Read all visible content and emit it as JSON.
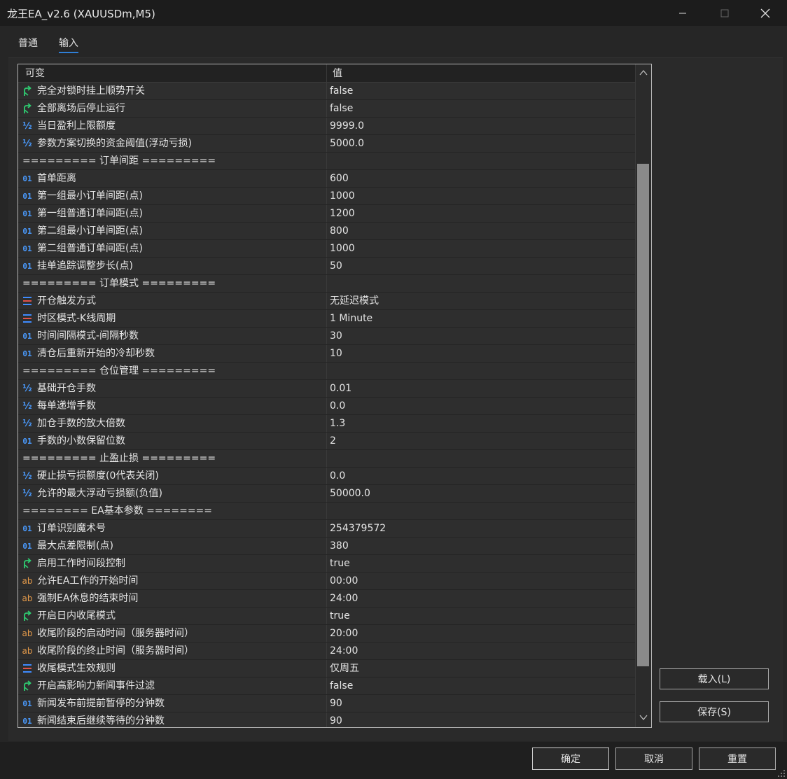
{
  "window": {
    "title": "龙王EA_v2.6 (XAUUSDm,M5)"
  },
  "tabs": [
    {
      "label": "普通"
    },
    {
      "label": "输入"
    }
  ],
  "grid": {
    "col_name": "可变",
    "col_value": "值"
  },
  "rows": [
    {
      "type": "bool",
      "name": "完全对锁时挂上顺势开关",
      "value": "false"
    },
    {
      "type": "bool",
      "name": "全部离场后停止运行",
      "value": "false"
    },
    {
      "type": "double",
      "name": "当日盈利上限额度",
      "value": "9999.0"
    },
    {
      "type": "double",
      "name": "参数方案切换的资金阈值(浮动亏损)",
      "value": "5000.0"
    },
    {
      "type": "separator",
      "name": "========= 订单间距 =========",
      "value": ""
    },
    {
      "type": "int",
      "name": "首单距离",
      "value": "600"
    },
    {
      "type": "int",
      "name": "第一组最小订单间距(点)",
      "value": "1000"
    },
    {
      "type": "int",
      "name": "第一组普通订单间距(点)",
      "value": "1200"
    },
    {
      "type": "int",
      "name": "第二组最小订单间距(点)",
      "value": "800"
    },
    {
      "type": "int",
      "name": "第二组普通订单间距(点)",
      "value": "1000"
    },
    {
      "type": "int",
      "name": "挂单追踪调整步长(点)",
      "value": "50"
    },
    {
      "type": "separator",
      "name": "========= 订单模式 =========",
      "value": ""
    },
    {
      "type": "enum",
      "name": "开仓触发方式",
      "value": "无延迟模式"
    },
    {
      "type": "enum",
      "name": "时区模式-K线周期",
      "value": "1 Minute"
    },
    {
      "type": "int",
      "name": "时间间隔模式-间隔秒数",
      "value": "30"
    },
    {
      "type": "int",
      "name": "清仓后重新开始的冷却秒数",
      "value": "10"
    },
    {
      "type": "separator",
      "name": "========= 仓位管理 =========",
      "value": ""
    },
    {
      "type": "double",
      "name": "基础开仓手数",
      "value": "0.01"
    },
    {
      "type": "double",
      "name": "每单递增手数",
      "value": "0.0"
    },
    {
      "type": "double",
      "name": "加仓手数的放大倍数",
      "value": "1.3"
    },
    {
      "type": "int",
      "name": "手数的小数保留位数",
      "value": "2"
    },
    {
      "type": "separator",
      "name": "========= 止盈止损 =========",
      "value": ""
    },
    {
      "type": "double",
      "name": "硬止损亏损额度(0代表关闭)",
      "value": "0.0"
    },
    {
      "type": "double",
      "name": "允许的最大浮动亏损额(负值)",
      "value": "50000.0"
    },
    {
      "type": "separator",
      "name": "======== EA基本参数 ========",
      "value": ""
    },
    {
      "type": "int",
      "name": "订单识别魔术号",
      "value": "254379572"
    },
    {
      "type": "int",
      "name": "最大点差限制(点)",
      "value": "380"
    },
    {
      "type": "bool",
      "name": "启用工作时间段控制",
      "value": "true"
    },
    {
      "type": "string",
      "name": "允许EA工作的开始时间",
      "value": "00:00"
    },
    {
      "type": "string",
      "name": "强制EA休息的结束时间",
      "value": "24:00"
    },
    {
      "type": "bool",
      "name": "开启日内收尾模式",
      "value": "true"
    },
    {
      "type": "string",
      "name": "收尾阶段的启动时间（服务器时间）",
      "value": "20:00"
    },
    {
      "type": "string",
      "name": "收尾阶段的终止时间（服务器时间）",
      "value": "24:00"
    },
    {
      "type": "enum",
      "name": "收尾模式生效规则",
      "value": "仅周五"
    },
    {
      "type": "bool",
      "name": "开启高影响力新闻事件过滤",
      "value": "false"
    },
    {
      "type": "int",
      "name": "新闻发布前提前暂停的分钟数",
      "value": "90"
    },
    {
      "type": "int",
      "name": "新闻结束后继续等待的分钟数",
      "value": "90"
    }
  ],
  "icons": {
    "bool": "arrow-branch-icon",
    "double": "half-fraction-icon",
    "int": "01-integer-icon",
    "enum": "enum-list-icon",
    "string": "ab-string-icon"
  },
  "icon_glyphs": {
    "int": "01",
    "double": "½",
    "string": "ab"
  },
  "buttons": {
    "load": "载入(L)",
    "save": "保存(S)",
    "ok": "确定",
    "cancel": "取消",
    "reset": "重置"
  },
  "colors": {
    "bool_icon": "#2ecc71",
    "int_icon": "#4a9bff",
    "double_icon": "#4a9bff",
    "string_icon": "#e49a4a",
    "enum_icon_a": "#3f8cff",
    "enum_icon_b": "#e0524a",
    "tab_underline": "#2f7fd6"
  }
}
